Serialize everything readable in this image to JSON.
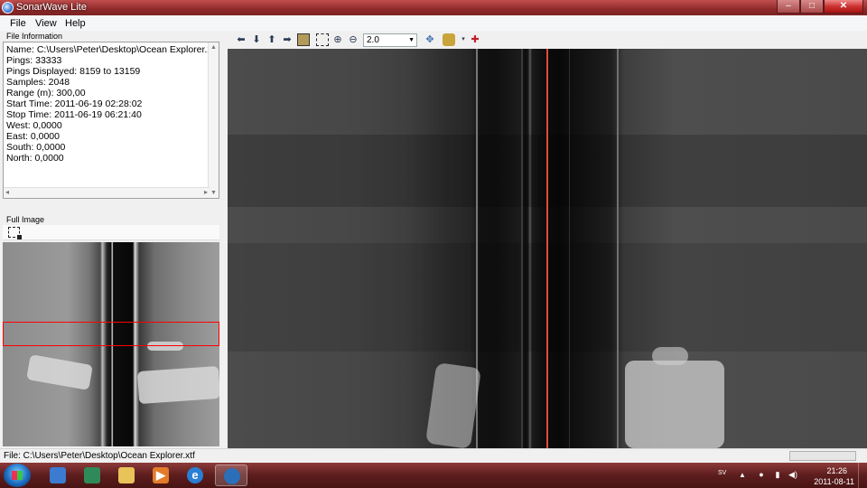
{
  "window": {
    "title": "SonarWave Lite",
    "min": "–",
    "max": "□",
    "close": "✕"
  },
  "menu": {
    "file": "File",
    "view": "View",
    "help": "Help"
  },
  "file_info": {
    "header": "File Information",
    "lines": [
      "Name: C:\\Users\\Peter\\Desktop\\Ocean Explorer.xtf",
      "Pings: 33333",
      "Pings Displayed: 8159 to 13159",
      "Samples: 2048",
      "Range (m): 300,00",
      "Start Time: 2011-06-19 02:28:02",
      "Stop Time: 2011-06-19 06:21:40",
      "West: 0,0000",
      "East: 0,0000",
      "South: 0,0000",
      "North: 0,0000"
    ]
  },
  "full_image": {
    "header": "Full Image"
  },
  "toolbar": {
    "zoom_value": "2.0",
    "icons": [
      "arrow-left-icon",
      "arrow-down-icon",
      "arrow-up-icon",
      "arrow-right-icon",
      "pan-image-icon",
      "zoom-fit-icon",
      "zoom-in-icon",
      "zoom-out-icon",
      "move-icon",
      "palette-icon",
      "magnet-icon"
    ]
  },
  "status": {
    "file": "File: C:\\Users\\Peter\\Desktop\\Ocean Explorer.xtf"
  },
  "taskbar": {
    "language": "SV",
    "time": "21:26",
    "date": "2011-08-11"
  },
  "colors": {
    "titlebar": "#8f2a2a",
    "selection": "#ff0000",
    "track_line": "#e24a3a",
    "taskbar": "#5c1d1d"
  }
}
